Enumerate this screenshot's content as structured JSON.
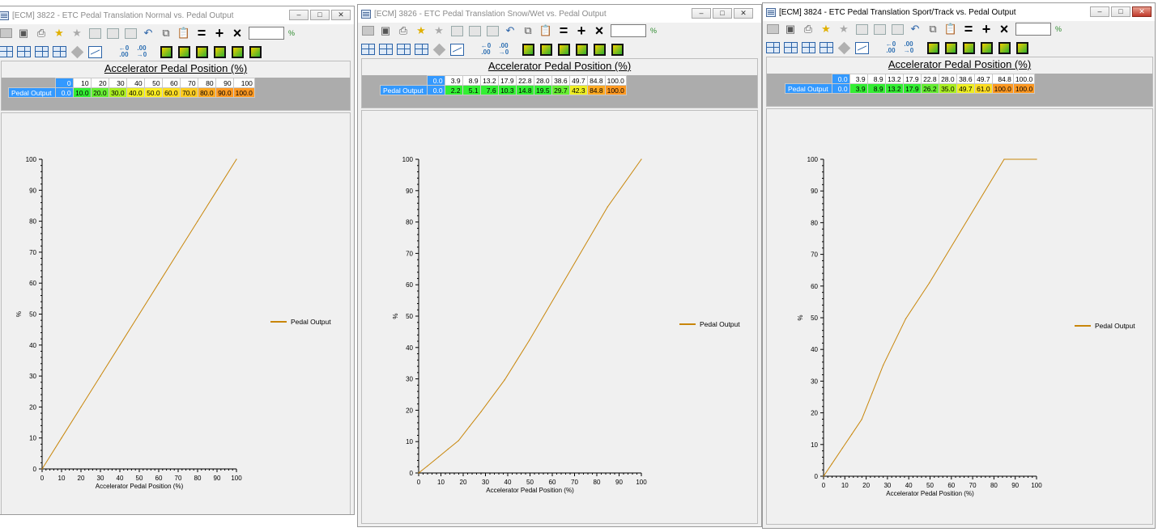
{
  "windows": [
    {
      "title": "[ECM] 3822 - ETC Pedal Translation Normal vs. Pedal Output",
      "active": false,
      "table": {
        "axis_title": "Accelerator Pedal Position (%)",
        "row_label": "Pedal Output",
        "headers": [
          "0",
          "10",
          "20",
          "30",
          "40",
          "50",
          "60",
          "70",
          "80",
          "90",
          "100"
        ],
        "values": [
          "0.0",
          "10.0",
          "20.0",
          "30.0",
          "40.0",
          "50.0",
          "60.0",
          "70.0",
          "80.0",
          "90.0",
          "100.0"
        ]
      },
      "chart_data": {
        "type": "line",
        "xlabel": "Accelerator Pedal Position (%)",
        "ylabel": "%",
        "xlim": [
          0,
          100
        ],
        "ylim": [
          0,
          100
        ],
        "xticks": [
          "0",
          "10",
          "20",
          "30",
          "40",
          "50",
          "60",
          "70",
          "80",
          "90",
          "100"
        ],
        "yticks": [
          "0",
          "10",
          "20",
          "30",
          "40",
          "50",
          "60",
          "70",
          "80",
          "90",
          "100"
        ],
        "series": [
          {
            "name": "Pedal Output",
            "color": "#c8860a",
            "x": [
              0,
              10,
              20,
              30,
              40,
              50,
              60,
              70,
              80,
              90,
              100
            ],
            "y": [
              0,
              10,
              20,
              30,
              40,
              50,
              60,
              70,
              80,
              90,
              100
            ]
          }
        ],
        "legend": "right"
      }
    },
    {
      "title": "[ECM] 3826 - ETC Pedal Translation Snow/Wet vs. Pedal Output",
      "active": false,
      "table": {
        "axis_title": "Accelerator Pedal Position (%)",
        "row_label": "Pedal Output",
        "headers": [
          "0.0",
          "3.9",
          "8.9",
          "13.2",
          "17.9",
          "22.8",
          "28.0",
          "38.6",
          "49.7",
          "84.8",
          "100.0"
        ],
        "values": [
          "0.0",
          "2.2",
          "5.1",
          "7.6",
          "10.3",
          "14.8",
          "19.5",
          "29.7",
          "42.3",
          "84.8",
          "100.0"
        ]
      },
      "chart_data": {
        "type": "line",
        "xlabel": "Accelerator Pedal Position (%)",
        "ylabel": "%",
        "xlim": [
          0,
          100
        ],
        "ylim": [
          0,
          100
        ],
        "xticks": [
          "0",
          "10",
          "20",
          "30",
          "40",
          "50",
          "60",
          "70",
          "80",
          "90",
          "100"
        ],
        "yticks": [
          "0",
          "10",
          "20",
          "30",
          "40",
          "50",
          "60",
          "70",
          "80",
          "90",
          "100"
        ],
        "series": [
          {
            "name": "Pedal Output",
            "color": "#c8860a",
            "x": [
              0.0,
              3.9,
              8.9,
              13.2,
              17.9,
              22.8,
              28.0,
              38.6,
              49.7,
              84.8,
              100.0
            ],
            "y": [
              0.0,
              2.2,
              5.1,
              7.6,
              10.3,
              14.8,
              19.5,
              29.7,
              42.3,
              84.8,
              100.0
            ]
          }
        ],
        "legend": "right"
      }
    },
    {
      "title": "[ECM] 3824 - ETC Pedal Translation Sport/Track vs. Pedal Output",
      "active": true,
      "table": {
        "axis_title": "Accelerator Pedal Position (%)",
        "row_label": "Pedal Output",
        "headers": [
          "0.0",
          "3.9",
          "8.9",
          "13.2",
          "17.9",
          "22.8",
          "28.0",
          "38.6",
          "49.7",
          "84.8",
          "100.0"
        ],
        "values": [
          "0.0",
          "3.9",
          "8.9",
          "13.2",
          "17.9",
          "26.2",
          "35.0",
          "49.7",
          "61.0",
          "100.0",
          "100.0"
        ]
      },
      "chart_data": {
        "type": "line",
        "xlabel": "Accelerator Pedal Position (%)",
        "ylabel": "%",
        "xlim": [
          0,
          100
        ],
        "ylim": [
          0,
          100
        ],
        "xticks": [
          "0",
          "10",
          "20",
          "30",
          "40",
          "50",
          "60",
          "70",
          "80",
          "90",
          "100"
        ],
        "yticks": [
          "0",
          "10",
          "20",
          "30",
          "40",
          "50",
          "60",
          "70",
          "80",
          "90",
          "100"
        ],
        "series": [
          {
            "name": "Pedal Output",
            "color": "#c8860a",
            "x": [
              0.0,
              3.9,
              8.9,
              13.2,
              17.9,
              22.8,
              28.0,
              38.6,
              49.7,
              84.8,
              100.0
            ],
            "y": [
              0.0,
              3.9,
              8.9,
              13.2,
              17.9,
              26.2,
              35.0,
              49.7,
              61.0,
              100.0,
              100.0
            ]
          }
        ],
        "legend": "right"
      }
    }
  ],
  "toolbar": {
    "percent_unit": "%",
    "window_buttons": {
      "minimize": "–",
      "maximize": "□",
      "close": "✕"
    }
  }
}
